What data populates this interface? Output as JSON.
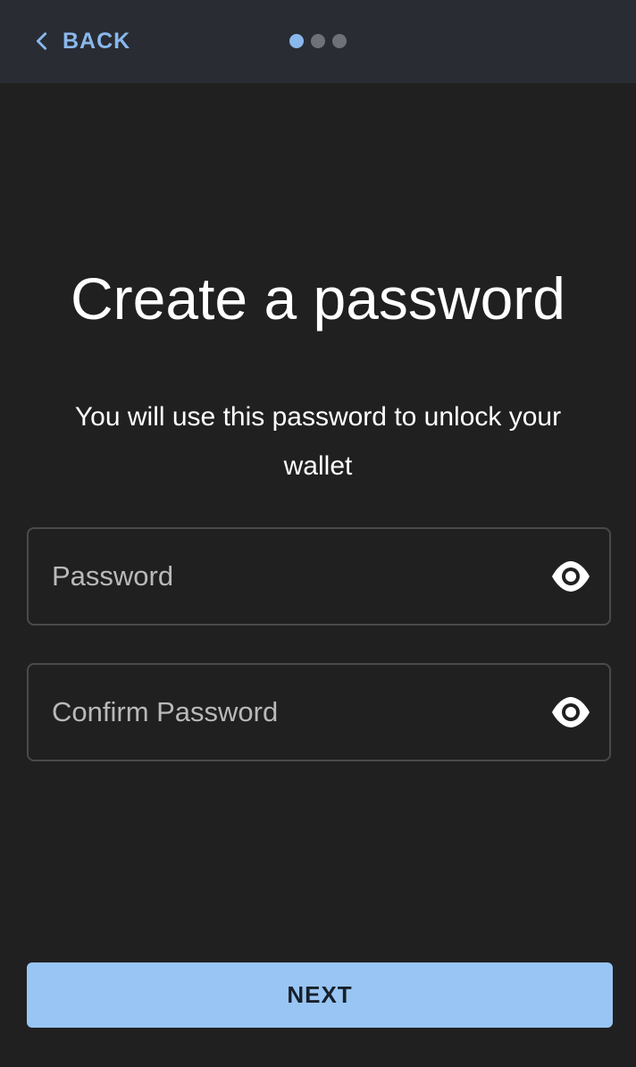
{
  "header": {
    "back_label": "BACK",
    "back_icon": "chevron-left-icon",
    "steps": {
      "total": 3,
      "current": 1
    },
    "accent_color": "#8ab8ec",
    "inactive_dot_color": "#6e7177"
  },
  "main": {
    "title": "Create a password",
    "subtitle": "You will use this password to unlock your wallet"
  },
  "form": {
    "password": {
      "value": "",
      "placeholder": "Password",
      "toggle_icon": "eye-icon"
    },
    "confirm_password": {
      "value": "",
      "placeholder": "Confirm Password",
      "toggle_icon": "eye-icon"
    }
  },
  "footer": {
    "next_label": "NEXT",
    "button_color": "#98c5f3"
  },
  "colors": {
    "background": "#202020",
    "topbar": "#292c33"
  }
}
